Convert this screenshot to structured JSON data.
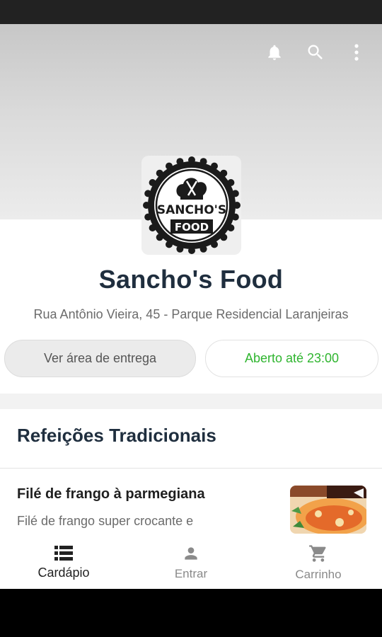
{
  "header": {
    "icons": [
      "bell-icon",
      "search-icon",
      "more-vert-icon"
    ]
  },
  "restaurant": {
    "logo_text_main": "SANCHO'S",
    "logo_text_sub": "FOOD",
    "name": "Sancho's Food",
    "address": "Rua Antônio Vieira, 45 - Parque Residencial Laranjeiras",
    "delivery_area_label": "Ver área de entrega",
    "open_status": "Aberto até 23:00"
  },
  "menu": {
    "section_title": "Refeições Tradicionais",
    "items": [
      {
        "name": "Filé de frango à parmegiana",
        "description": "Filé de frango super crocante e"
      }
    ]
  },
  "bottom_nav": {
    "items": [
      {
        "label": "Cardápio",
        "icon": "menu-list-icon",
        "active": true
      },
      {
        "label": "Entrar",
        "icon": "person-icon",
        "active": false
      },
      {
        "label": "Carrinho",
        "icon": "cart-icon",
        "active": false
      }
    ]
  },
  "colors": {
    "title": "#1f2e3e",
    "open_green": "#2fb52f",
    "nav_inactive": "#8a8a8a"
  }
}
